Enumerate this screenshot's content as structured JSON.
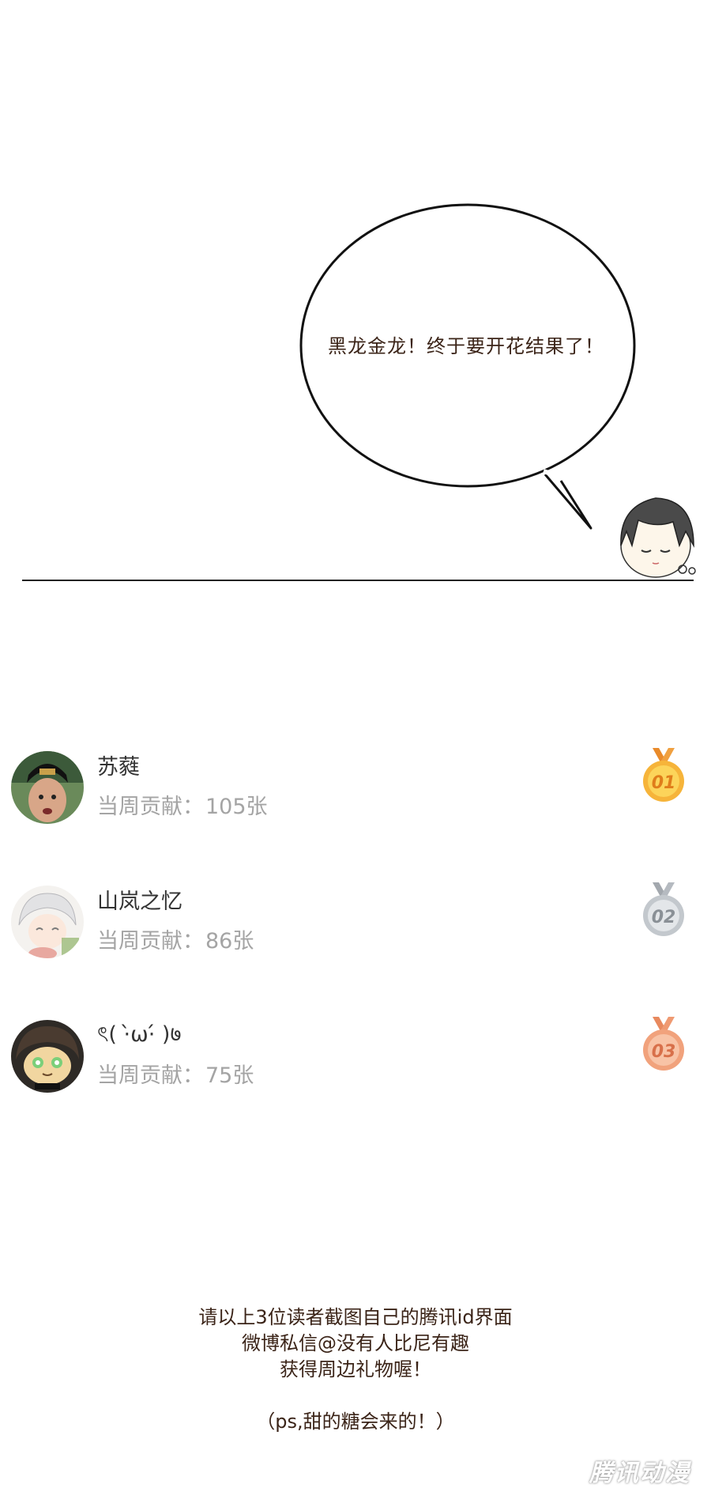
{
  "speech_bubble": {
    "text": "黑龙金龙！终于要开花结果了！"
  },
  "ranking": [
    {
      "username": "苏蕤",
      "contribution_label": "当周贡献：",
      "contribution_value": "105张",
      "medal": "01",
      "medal_color": "#f6b43a",
      "avatar_icon": "avatar-icon"
    },
    {
      "username": "山岚之忆",
      "contribution_label": "当周贡献：",
      "contribution_value": "86张",
      "medal": "02",
      "medal_color": "#bfc4c9",
      "avatar_icon": "avatar-icon"
    },
    {
      "username": "ৎ( ·̀ω·́ )७",
      "contribution_label": "当周贡献：",
      "contribution_value": "75张",
      "medal": "03",
      "medal_color": "#f1a27c",
      "avatar_icon": "avatar-icon"
    }
  ],
  "footer": {
    "line1": "请以上3位读者截图自己的腾讯id界面",
    "line2": "微博私信@没有人比尼有趣",
    "line3": "获得周边礼物喔！",
    "line4": "（ps,甜的糖会来的！）"
  },
  "watermark": "腾讯动漫",
  "colors": {
    "text_dark": "#3b2418",
    "text_gray": "#a4a4a4",
    "gold": "#f6b43a",
    "silver": "#bfc4c9",
    "bronze": "#f1a27c"
  }
}
